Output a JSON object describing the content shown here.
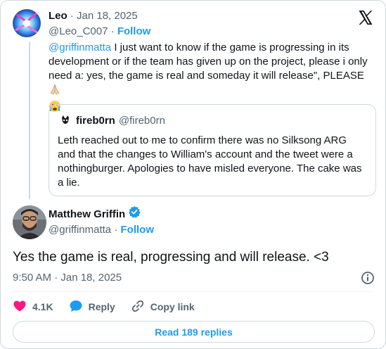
{
  "reply": {
    "author_name": "Leo",
    "date": "Jan 18, 2025",
    "handle": "@Leo_C007",
    "follow_label": "Follow",
    "separator": "·",
    "mention": "@griffinmatta",
    "text": " I just want to know if the game is progressing in its development or if the team has given up on the project, please i only need a: yes, the game is real and someday it will release\", PLEASE "
  },
  "quote": {
    "author_name": "fireb0rn",
    "handle": "@fireb0rn",
    "text": "Leth reached out to me to confirm there was no Silksong ARG and that the changes to William's account and the tweet were a nothingburger. Apologies to have misled everyone. The cake was a lie."
  },
  "main": {
    "author_name": "Matthew Griffin",
    "handle": "@griffinmatta",
    "follow_label": "Follow",
    "separator": "·",
    "text": "Yes the game is real, progressing and will release. <3",
    "timestamp": "9:50 AM · Jan 18, 2025"
  },
  "actions": {
    "likes": "4.1K",
    "reply_label": "Reply",
    "copy_link_label": "Copy link"
  },
  "read_replies_label": "Read 189 replies",
  "colors": {
    "accent": "#1d9bf0",
    "like": "#f91880",
    "text": "#0f1419",
    "muted": "#536471",
    "border": "#cfd9de"
  },
  "icons": [
    "x-logo-icon",
    "verified-badge-icon",
    "heart-icon",
    "reply-bubble-icon",
    "copy-link-icon",
    "info-icon",
    "praying-hands-emoji",
    "crying-face-emoji"
  ]
}
